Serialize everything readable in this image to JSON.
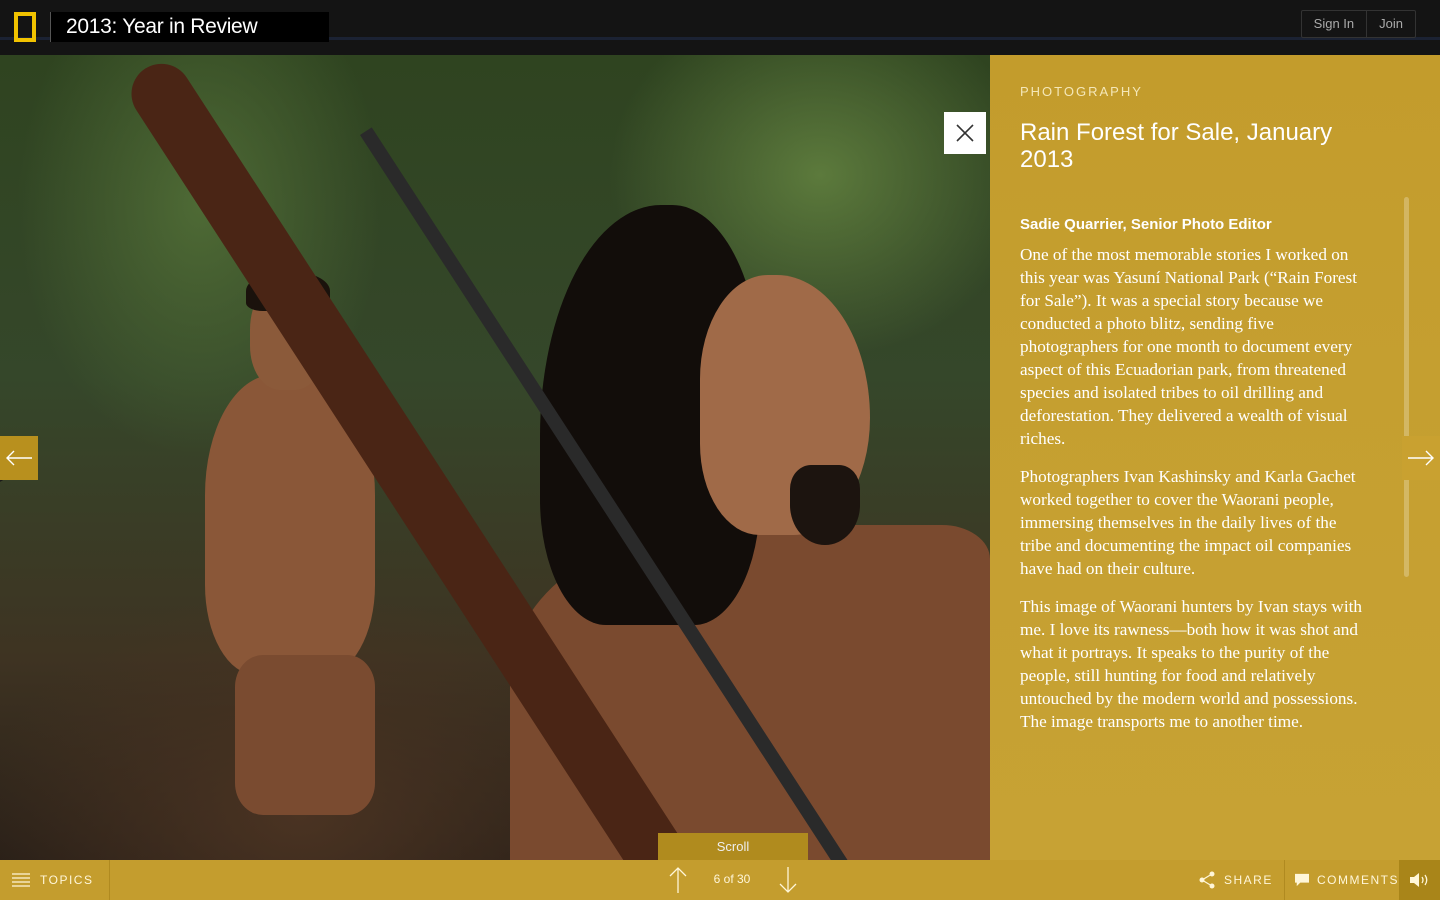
{
  "header": {
    "title": "2013: Year in Review",
    "sign_in": "Sign In",
    "join": "Join"
  },
  "article": {
    "category": "PHOTOGRAPHY",
    "title": "Rain Forest for Sale, January 2013",
    "author": "Sadie Quarrier, Senior Photo Editor",
    "paragraphs": [
      "One of the most memorable stories I worked on this year was Yasuní National Park (“Rain Forest for Sale”). It was a special story because we conducted a photo blitz, sending five photographers for one month to document every aspect of this Ecuadorian park, from threatened species and isolated tribes to oil drilling and deforestation. They delivered a wealth of visual riches.",
      "Photographers Ivan Kashinsky and Karla Gachet worked together to cover the Waorani people, immersing themselves in the daily lives of the tribe and documenting the impact oil companies have had on their culture.",
      "This image of Waorani hunters by Ivan stays with me. I love its rawness—both how it was shot and what it portrays. It speaks to the purity of the people, still hunting for food and relatively untouched by the modern world and possessions. The image transports me to another time."
    ]
  },
  "scroll_label": "Scroll",
  "footer": {
    "topics": "TOPICS",
    "page_count": "6 of 30",
    "share": "SHARE",
    "comments": "COMMENTS"
  },
  "colors": {
    "accent_yellow": "#f2c300",
    "panel_gold": "#c49d2e"
  },
  "icons": {
    "logo": "natgeo-yellow-border-icon",
    "close": "close-icon",
    "prev": "arrow-left-icon",
    "next": "arrow-right-icon",
    "menu": "menu-icon",
    "up": "arrow-up-icon",
    "down": "arrow-down-icon",
    "share": "share-icon",
    "comments": "comment-icon",
    "sound": "speaker-icon"
  }
}
